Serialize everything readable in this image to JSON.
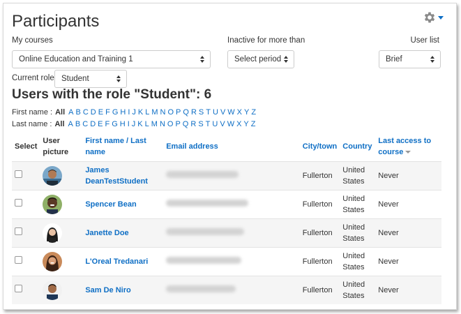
{
  "page": {
    "title": "Participants"
  },
  "filters": {
    "my_courses_label": "My courses",
    "my_courses_value": "Online Education and Training 1",
    "inactive_label": "Inactive for more than",
    "inactive_value": "Select period",
    "user_list_label": "User list",
    "user_list_value": "Brief",
    "current_role_label": "Current role",
    "current_role_value": "Student"
  },
  "heading": "Users with the role \"Student\": 6",
  "initials": {
    "first_label": "First name :",
    "last_label": "Last name :",
    "all": "All",
    "letters": [
      "A",
      "B",
      "C",
      "D",
      "E",
      "F",
      "G",
      "H",
      "I",
      "J",
      "K",
      "L",
      "M",
      "N",
      "O",
      "P",
      "Q",
      "R",
      "S",
      "T",
      "U",
      "V",
      "W",
      "X",
      "Y",
      "Z"
    ]
  },
  "table": {
    "headers": {
      "select": "Select",
      "picture": "User picture",
      "name": "First name / Last name",
      "email": "Email address",
      "city": "City/town",
      "country": "Country",
      "access": "Last access to course"
    },
    "rows": [
      {
        "name": "James DeanTestStudent",
        "city": "Fullerton",
        "country": "United States",
        "access": "Never",
        "avatar": "avatar-1"
      },
      {
        "name": "Spencer Bean",
        "city": "Fullerton",
        "country": "United States",
        "access": "Never",
        "avatar": "avatar-2"
      },
      {
        "name": "Janette Doe",
        "city": "Fullerton",
        "country": "United States",
        "access": "Never",
        "avatar": "avatar-3"
      },
      {
        "name": "L'Oreal Tredanari",
        "city": "Fullerton",
        "country": "United States",
        "access": "Never",
        "avatar": "avatar-4"
      },
      {
        "name": "Sam De Niro",
        "city": "Fullerton",
        "country": "United States",
        "access": "Never",
        "avatar": "avatar-5"
      }
    ]
  },
  "colors": {
    "link": "#0f6fc5",
    "text": "#333333",
    "row_stripe": "#f5f5f5"
  },
  "icons": {
    "settings": "gear-icon",
    "sort": "sort-descending-icon"
  }
}
